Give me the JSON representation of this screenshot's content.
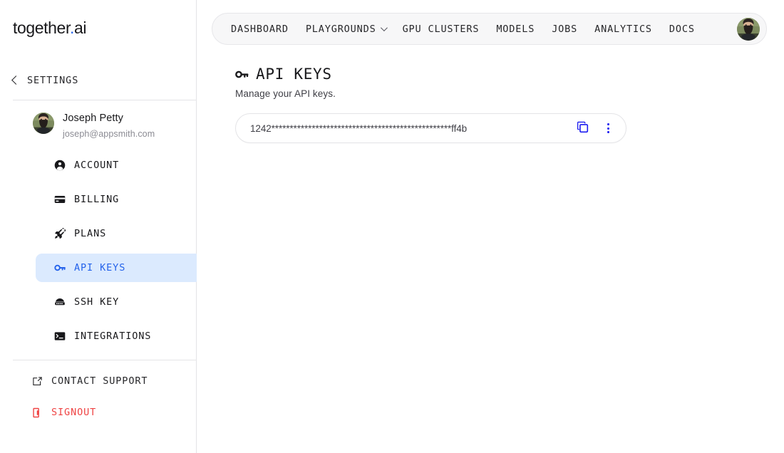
{
  "brand": {
    "name_main": "together",
    "name_dot": ".",
    "name_suffix": "ai",
    "accent_color": "#2563eb"
  },
  "sidebar": {
    "back_label": "SETTINGS",
    "back_icon": "chevron-left-icon",
    "user": {
      "name": "Joseph Petty",
      "email": "joseph@appsmith.com",
      "avatar_icon": "user-avatar-photo"
    },
    "items": [
      {
        "label": "ACCOUNT",
        "icon": "account-circle-icon",
        "active": false
      },
      {
        "label": "BILLING",
        "icon": "credit-card-icon",
        "active": false
      },
      {
        "label": "PLANS",
        "icon": "rocket-icon",
        "active": false
      },
      {
        "label": "API KEYS",
        "icon": "key-icon",
        "active": true
      },
      {
        "label": "SSH KEY",
        "icon": "server-icon",
        "active": false
      },
      {
        "label": "INTEGRATIONS",
        "icon": "terminal-icon",
        "active": false
      }
    ],
    "bottom_links": [
      {
        "label": "CONTACT SUPPORT",
        "icon": "external-link-icon",
        "style": "default"
      },
      {
        "label": "SIGNOUT",
        "icon": "logout-icon",
        "style": "danger"
      }
    ],
    "active_bg_color": "#dbeafe",
    "active_text_color": "#2563eb",
    "danger_color": "#ef4444"
  },
  "topnav": {
    "items": [
      {
        "label": "DASHBOARD",
        "has_chevron": false
      },
      {
        "label": "PLAYGROUNDS",
        "has_chevron": true
      },
      {
        "label": "GPU CLUSTERS",
        "has_chevron": false
      },
      {
        "label": "MODELS",
        "has_chevron": false
      },
      {
        "label": "JOBS",
        "has_chevron": false
      },
      {
        "label": "ANALYTICS",
        "has_chevron": false
      },
      {
        "label": "DOCS",
        "has_chevron": false
      }
    ],
    "avatar_icon": "user-avatar-photo"
  },
  "page": {
    "title": "API KEYS",
    "title_icon": "key-icon",
    "subtitle": "Manage your API keys."
  },
  "api_keys": [
    {
      "masked_value": "1242*************************************************ff4b",
      "prefix": "1242",
      "suffix": "ff4b",
      "copy_icon": "copy-icon",
      "menu_icon": "more-vertical-icon",
      "action_color": "#1a1af0"
    }
  ]
}
